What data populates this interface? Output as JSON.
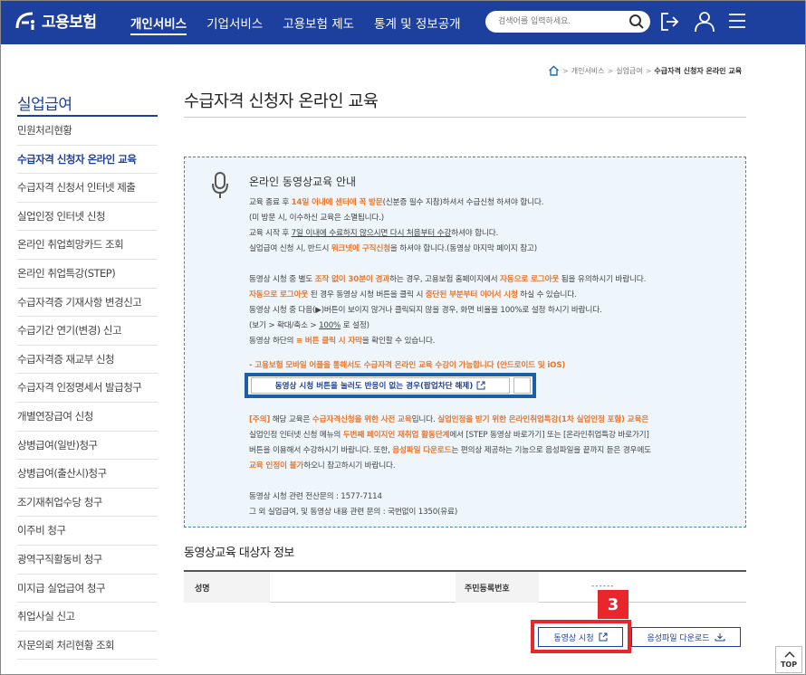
{
  "header": {
    "logo_text": "고용보험",
    "nav": [
      "개인서비스",
      "기업서비스",
      "고용보험 제도",
      "통계 및 정보공개"
    ],
    "search_placeholder": "검색어를 입력하세요."
  },
  "breadcrumb": [
    "개인서비스",
    "실업급여",
    "수급자격 신청자 온라인 교육"
  ],
  "sidebar": {
    "title": "실업급여",
    "items": [
      "민원처리현황",
      "수급자격 신청자 온라인 교육",
      "수급자격 신청서 인터넷 제출",
      "실업인정 인터넷 신청",
      "온라인 취업희망카드 조회",
      "온라인 취업특강(STEP)",
      "수급자격증 기재사항 변경신고",
      "수급기간 연기(변경) 신고",
      "수급자격증 재교부 신청",
      "수급자격 인정명세서 발급청구",
      "개별연장급여 신청",
      "상병급여(일반)청구",
      "상병급여(출산시)청구",
      "조기재취업수당 청구",
      "이주비 청구",
      "광역구직활동비 청구",
      "미지급 실업급여 청구",
      "취업사실 신고",
      "자문의뢰 처리현황 조회"
    ]
  },
  "page_title": "수급자격 신청자 온라인 교육",
  "info": {
    "title": "온라인 동영상교육 안내",
    "l1a": "교육 종료 후 ",
    "l1b": "14일 이내에 센터에 꼭 방문",
    "l1c": "(신분증 필수 지참)하셔서 수급신청 하셔야 합니다.",
    "l2": "(미 방문 시, 이수하신 교육은 소멸됩니다.)",
    "l3a": "교육 시작 후 ",
    "l3b": "7일 이내에 수료하지 않으시면 다시 처음부터 수강",
    "l3c": "하셔야 합니다.",
    "l4a": "실업급여 신청 시, 반드시 ",
    "l4b": "워크넷에 구직신청",
    "l4c": "을 하셔야 합니다.(동영상 마지막 페이지 참고)",
    "l5a": "동영상 시청 중 별도 ",
    "l5b": "조작 없이 30분이 경과",
    "l5c": "하는 경우, 고용보험 홈페이지에서 ",
    "l5d": "자동으로 로그아웃",
    "l5e": " 됨을 유의하시기 바랍니다.",
    "l6a": "자동으로 로그아웃",
    "l6b": " 된 경우 동영상 시청 버튼을 클릭 시 ",
    "l6c": "중단된 부분부터 이어서 시청",
    "l6d": " 하실 수 있습니다.",
    "l7": "동영상 시청 중 다음(▶)버튼이 보이지 않거나 클릭되지 않을 경우, 화면 비율을 100%로 설정 하시기 바랍니다.",
    "l8a": "(보기 > 확대/축소 > ",
    "l8b": "100%",
    "l8c": " 로 설정)",
    "l9a": "동영상 하단의 ",
    "l9b": "≡ 버튼 클릭 시 자막",
    "l9c": "을 확인할 수 있습니다.",
    "l10": "- 고용보험 모바일 어플을 통해서도 수급자격 온라인 교육 수강이 가능합니다 (안드로이드 및 iOS)",
    "popup_button": "동영상 시청 버튼을 눌러도 반응이 없는 경우(팝업차단 해제)",
    "n1a": "[주의]",
    "n1b": " 해당 교육은 ",
    "n1c": "수급자격신청을 위한 사전 교육",
    "n1d": "입니다. ",
    "n1e": "실업인정을 받기 위한 온라인취업특강(1차 실업인정 포함) 교육은",
    "n2a": "실업인정 인터넷 신청 메뉴의 ",
    "n2b": "두번째 페이지인 재취업 활동단계",
    "n2c": "에서 [STEP 동영상 바로가기] 또는 [온라인취업특강 바로가기]",
    "n3a": "버튼을 이용해서 수강하시기 바랍니다. 또한, ",
    "n3b": "음성파일 다운로드",
    "n3c": "는 편의상 제공하는 기능으로 음성파일을 끝까지 듣은 경우에도",
    "n4a": "교육 인정이 불가",
    "n4b": "하오니 참고하시기 바랍니다.",
    "c1": "동영상 시청 관련 전산문의 : 1577-7114",
    "c2": "그 외 실업급여, 및 동영상 내용 관련 문의 : 국번없이 1350(유료)"
  },
  "target": {
    "title": "동영상교육 대상자 정보",
    "name_label": "성명",
    "id_label": "주민등록번호",
    "id_value": "------"
  },
  "step_label": "3",
  "buttons": {
    "video": "동영상 시청",
    "audio": "음성파일 다운로드"
  },
  "top_label": "TOP",
  "colors": {
    "header_bg": "#1d3f9e",
    "accent_orange": "#e8772e",
    "highlight_red": "#e8262b",
    "highlight_blue": "#1a5fa8"
  }
}
